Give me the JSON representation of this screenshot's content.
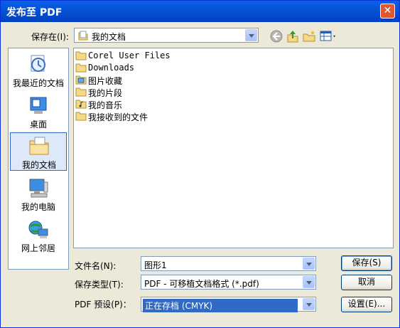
{
  "window": {
    "title": "发布至 PDF",
    "close_symbol": "✕"
  },
  "save_in": {
    "label": "保存在(I):",
    "value": "我的文档"
  },
  "places": [
    {
      "label": "我最近的文档",
      "icon": "recent-documents-icon"
    },
    {
      "label": "桌面",
      "icon": "desktop-icon"
    },
    {
      "label": "我的文档",
      "icon": "my-documents-icon",
      "selected": true
    },
    {
      "label": "我的电脑",
      "icon": "my-computer-icon"
    },
    {
      "label": "网上邻居",
      "icon": "network-places-icon"
    }
  ],
  "files": [
    {
      "name": "Corel User Files",
      "icon": "folder-icon"
    },
    {
      "name": "Downloads",
      "icon": "folder-icon"
    },
    {
      "name": "图片收藏",
      "icon": "pictures-folder-icon"
    },
    {
      "name": "我的片段",
      "icon": "folder-icon"
    },
    {
      "name": "我的音乐",
      "icon": "music-folder-icon"
    },
    {
      "name": "我接收到的文件",
      "icon": "folder-icon"
    }
  ],
  "filename": {
    "label": "文件名(N):",
    "value": "图形1"
  },
  "filetype": {
    "label": "保存类型(T):",
    "value": "PDF - 可移植文档格式 (*.pdf)"
  },
  "preset": {
    "label": "PDF 预设(P)：",
    "value": "正在存档 (CMYK)"
  },
  "buttons": {
    "save": "保存(S)",
    "cancel": "取消",
    "settings": "设置(E)..."
  },
  "colors": {
    "titlebar": "#0654d6",
    "accent": "#316ac5",
    "dialog_bg": "#ece9d8"
  }
}
